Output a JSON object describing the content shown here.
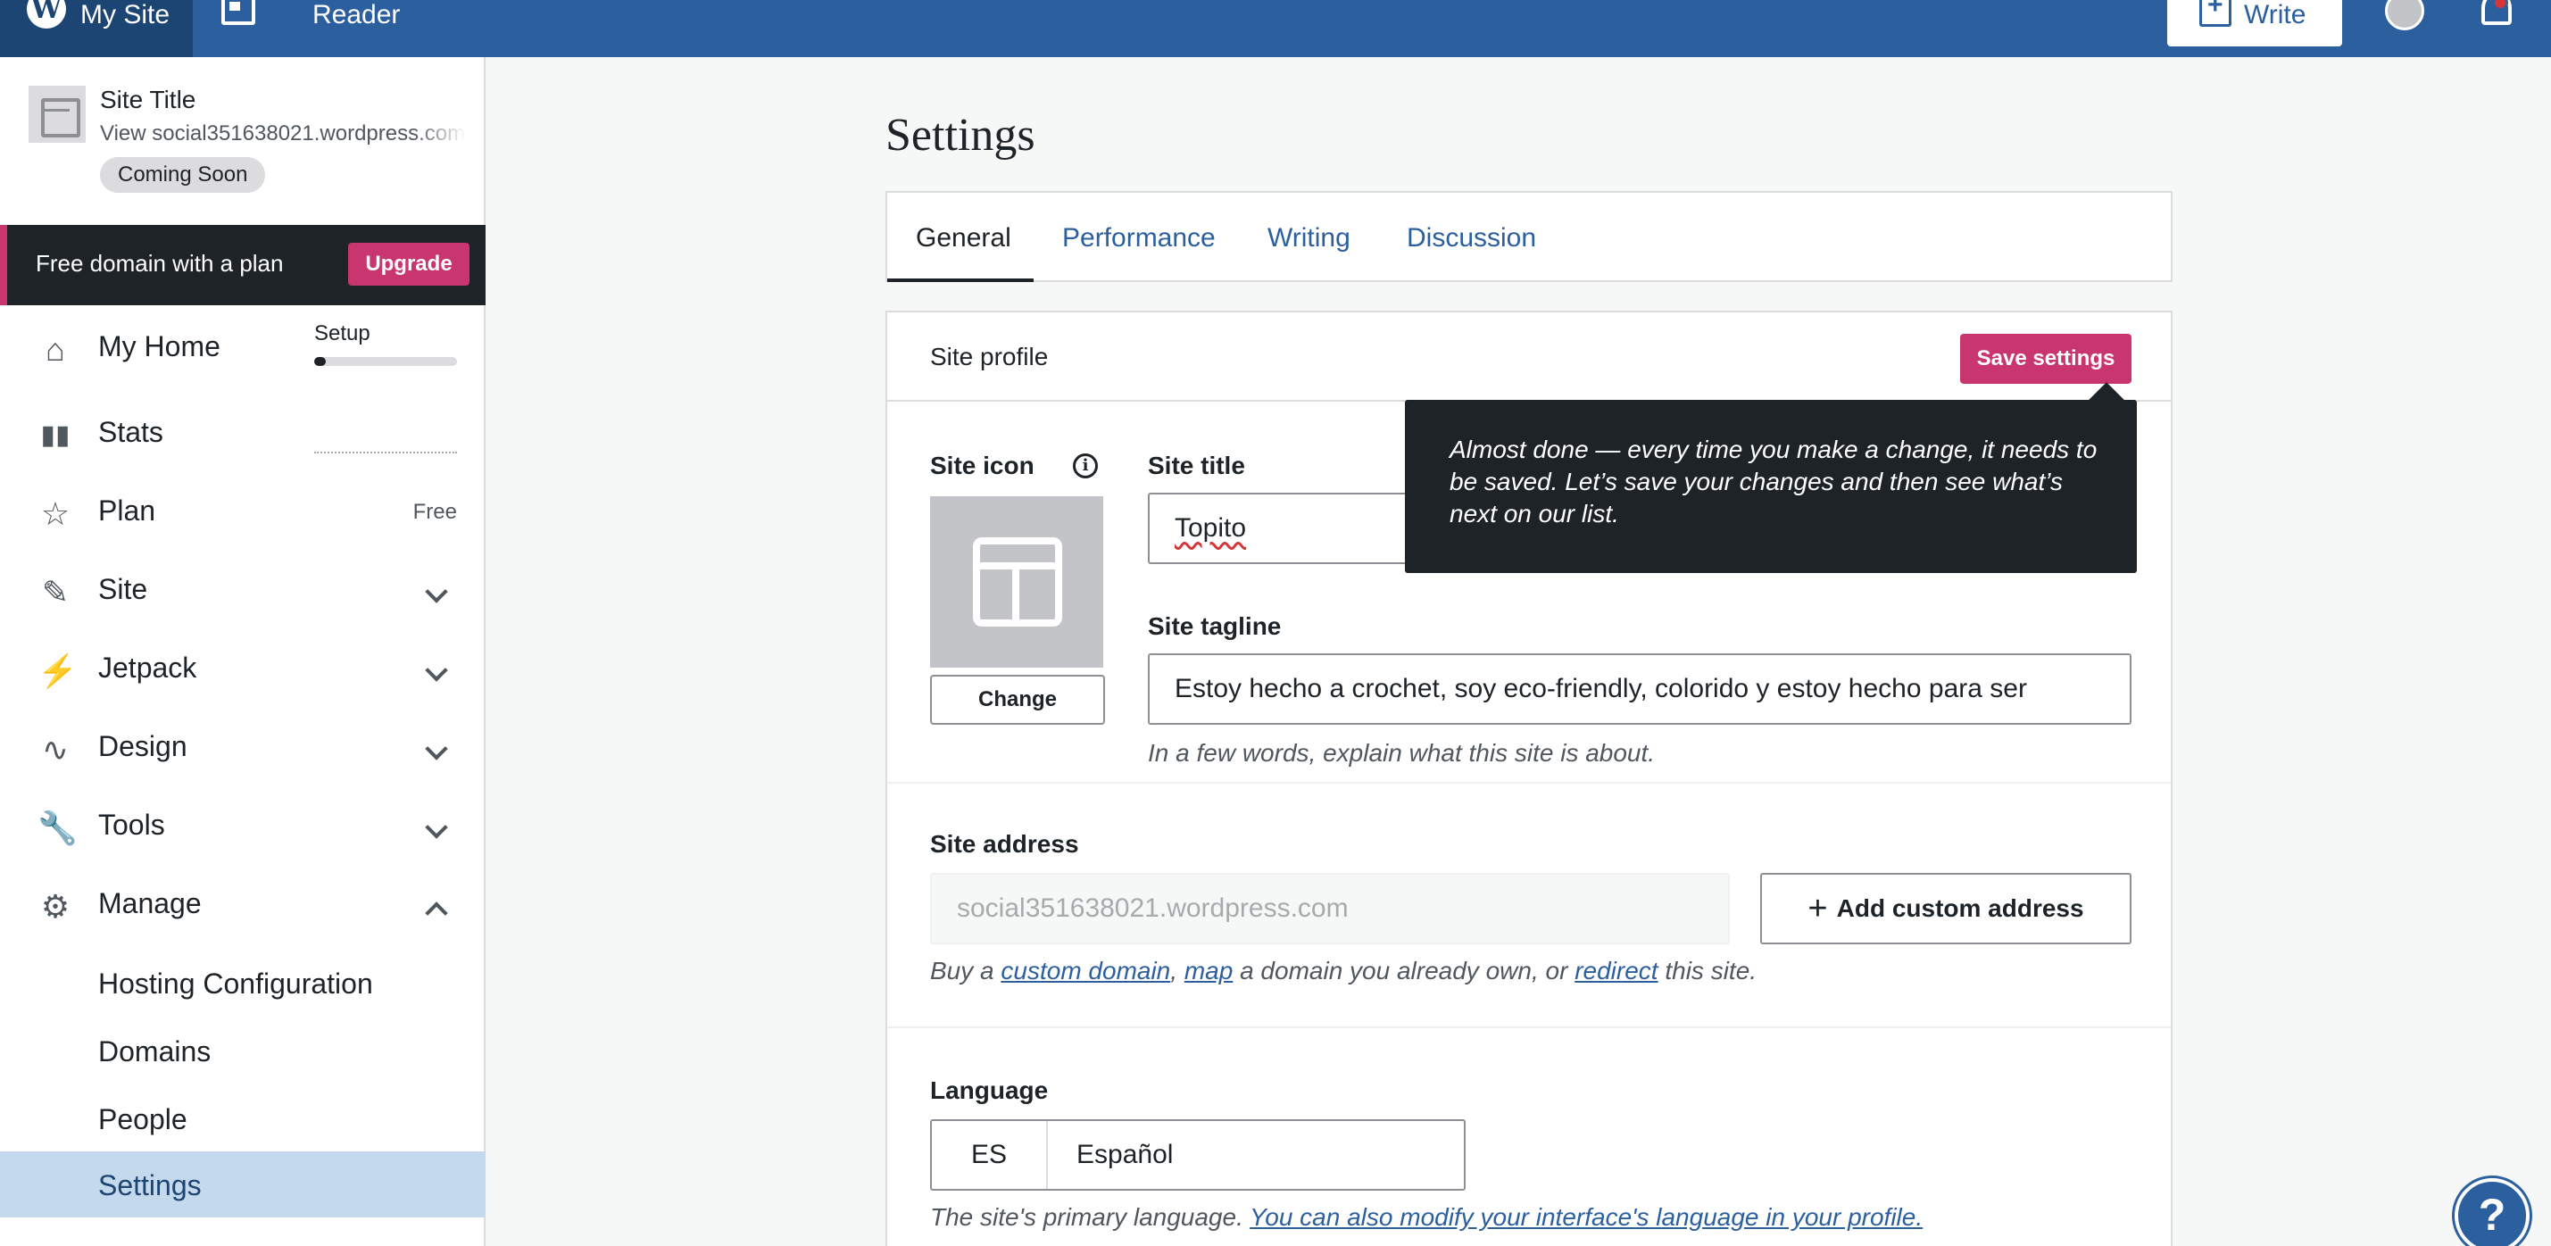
{
  "topbar": {
    "mysite_label": "My Site",
    "reader_label": "Reader",
    "write_label": "Write"
  },
  "sidebar": {
    "site_title": "Site Title",
    "site_url": "View social351638021.wordpress.com",
    "badge": "Coming Soon",
    "promo_text": "Free domain with a plan",
    "promo_button": "Upgrade",
    "setup_label": "Setup",
    "setup_progress": 0.08,
    "items": [
      {
        "label": "My Home",
        "icon": "home-icon"
      },
      {
        "label": "Stats",
        "icon": "stats-icon"
      },
      {
        "label": "Plan",
        "icon": "star-icon",
        "right": "Free"
      },
      {
        "label": "Site",
        "icon": "pencil-icon"
      },
      {
        "label": "Jetpack",
        "icon": "jetpack-icon"
      },
      {
        "label": "Design",
        "icon": "design-icon"
      },
      {
        "label": "Tools",
        "icon": "wrench-icon"
      },
      {
        "label": "Manage",
        "icon": "gear-icon"
      }
    ],
    "manage_sub": [
      "Hosting Configuration",
      "Domains",
      "People",
      "Settings"
    ],
    "active_color": "#c5d9ed"
  },
  "main": {
    "page_title": "Settings",
    "tabs": [
      "General",
      "Performance",
      "Writing",
      "Discussion"
    ],
    "active_tab": "General",
    "card_title": "Site profile",
    "save_button": "Save settings",
    "site_icon_label": "Site icon",
    "change_button": "Change",
    "site_title_label": "Site title",
    "site_title_value": "Topito",
    "tooltip_text": "Almost done — every time you make a change, it needs to be saved. Let’s save your changes and then see what’s next on our list.",
    "site_tagline_label": "Site tagline",
    "site_tagline_value": "Estoy hecho a crochet, soy eco-friendly, colorido y estoy hecho para ser",
    "tagline_help": "In a few words, explain what this site is about.",
    "site_address_label": "Site address",
    "site_address_value": "social351638021.wordpress.com",
    "add_custom_address": "Add custom address",
    "address_help": {
      "part1": "Buy a ",
      "link1": "custom domain",
      "part2": ", ",
      "link2": "map",
      "part3": " a domain you already own, or ",
      "link3": "redirect",
      "part4": " this site."
    },
    "language_label": "Language",
    "language_code": "ES",
    "language_name": "Español",
    "language_help": "The site's primary language. ",
    "language_help_link": "You can also modify your interface's language in your profile."
  },
  "colors": {
    "topbar": "#2c5f9e",
    "accent": "#c9356e",
    "link": "#2c5f9e"
  }
}
